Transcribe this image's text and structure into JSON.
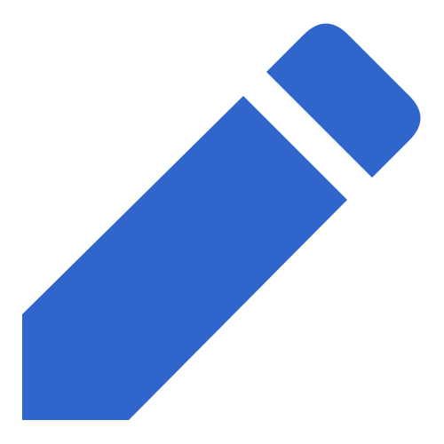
{
  "icon": {
    "name": "pencil-icon",
    "color": "#3066cc"
  }
}
